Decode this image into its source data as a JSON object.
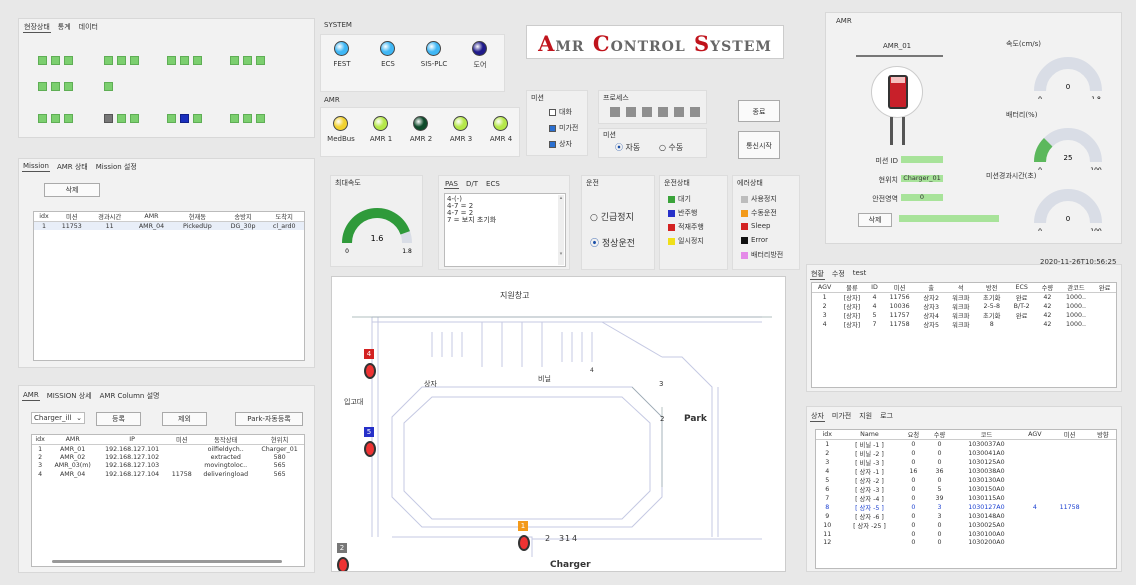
{
  "left_top": {
    "tabs": [
      "현장상태",
      "통계",
      "데이터"
    ]
  },
  "mission_panel": {
    "tabs": [
      "Mission",
      "AMR 상태",
      "Mission 설정"
    ],
    "delete_btn": "삭제",
    "headers": [
      "idx",
      "미션",
      "경과시간",
      "AMR",
      "현재동",
      "송방지",
      "도착지"
    ],
    "rows": [
      [
        "1",
        "11753",
        "11",
        "AMR_04",
        "PickedUp",
        "DG_30p",
        "cl_ard0"
      ]
    ]
  },
  "amr_panel": {
    "tabs": [
      "AMR",
      "MISSION 상세",
      "AMR Column 설명"
    ],
    "select_value": "Charger_ill",
    "btn_register": "등록",
    "btn_delete": "제외",
    "btn_park": "Park-자동등록",
    "headers": [
      "idx",
      "AMR",
      "IP",
      "미션",
      "동작상태",
      "현위치"
    ],
    "rows": [
      [
        "1",
        "AMR_01",
        "192.168.127.101",
        "",
        "oilfieldych..",
        "Charger_01"
      ],
      [
        "2",
        "AMR_02",
        "192.168.127.102",
        "",
        "extracted",
        "580"
      ],
      [
        "3",
        "AMR_03(m)",
        "192.168.127.103",
        "",
        "movingtoloc..",
        "565"
      ],
      [
        "4",
        "AMR_04",
        "192.168.127.104",
        "11758",
        "deliveringload",
        "565"
      ]
    ]
  },
  "system": {
    "title": "SYSTEM",
    "leds": [
      {
        "label": "FEST",
        "color": "#3fb7f5"
      },
      {
        "label": "ECS",
        "color": "#3fb7f5"
      },
      {
        "label": "SIS-PLC",
        "color": "#3fb7f5"
      },
      {
        "label": "도어",
        "color": "#1f1a8a"
      }
    ]
  },
  "amr_leds": {
    "title": "AMR",
    "leds": [
      {
        "label": "MedBus",
        "color": "#f2d230"
      },
      {
        "label": "AMR 1",
        "color": "#b6e84a"
      },
      {
        "label": "AMR 2",
        "color": "#0d4a2a"
      },
      {
        "label": "AMR 3",
        "color": "#b6e84a"
      },
      {
        "label": "AMR 4",
        "color": "#b6e84a"
      }
    ]
  },
  "brand": {
    "title": "AMR CONTROL SYSTEM"
  },
  "mission_opts": {
    "title": "미션",
    "items": [
      {
        "label": "대화",
        "checked": false
      },
      {
        "label": "미가전",
        "checked": true
      },
      {
        "label": "상자",
        "checked": true
      }
    ]
  },
  "process": {
    "title": "프로세스"
  },
  "mode": {
    "title": "미션",
    "auto": "자동",
    "manual": "수동"
  },
  "btn_end": "종료",
  "btn_comm": "통신시작",
  "speed": {
    "title": "최대속도",
    "value": "1.6",
    "min": "0",
    "max": "1.8",
    "fill": 0.89
  },
  "log_panel": {
    "tabs": [
      "PAS",
      "D/T",
      "ECS"
    ],
    "lines": [
      "4-(-)",
      "4-7  =  2",
      "4-7  =  2",
      "7  =  보지 초기화"
    ]
  },
  "run": {
    "title": "운전",
    "emergency": "긴급정지",
    "normal": "정상운전"
  },
  "run_state": {
    "title": "운전상태",
    "items": [
      {
        "label": "대기",
        "color": "#3aa33a"
      },
      {
        "label": "반주행",
        "color": "#2630c9"
      },
      {
        "label": "적재주행",
        "color": "#d32222"
      },
      {
        "label": "일시정지",
        "color": "#f0df1a"
      }
    ]
  },
  "err_state": {
    "title": "에러상태",
    "items": [
      {
        "label": "사용정지",
        "color": "#bdbdbd"
      },
      {
        "label": "수동운전",
        "color": "#f39a1a"
      },
      {
        "label": "Sleep",
        "color": "#d32222"
      },
      {
        "label": "Error",
        "color": "#111111"
      },
      {
        "label": "배터리방전",
        "color": "#e48ae8"
      }
    ]
  },
  "map": {
    "labels": [
      "지원창고",
      "상자",
      "비닐",
      "입고대",
      "Park",
      "Charger",
      "1",
      "2",
      "3",
      "4",
      "2",
      "3",
      "4"
    ],
    "markers": [
      {
        "n": "4",
        "color": "#d32222"
      },
      {
        "n": "5",
        "color": "#2630c9"
      },
      {
        "n": "1",
        "color": "#f39a1a"
      },
      {
        "n": "2",
        "color": "#777777"
      }
    ]
  },
  "amr_detail": {
    "title": "AMR",
    "name": "AMR_01",
    "fields": [
      {
        "label": "미션 ID",
        "value": ""
      },
      {
        "label": "현위치",
        "value": "Charger_01"
      },
      {
        "label": "안전영역",
        "value": "0"
      }
    ],
    "delete_btn": "삭제",
    "g1": {
      "title": "속도(cm/s)",
      "value": "0",
      "min": "0",
      "max": "1.8",
      "fill": 0
    },
    "g2": {
      "title": "배터리(%)",
      "value": "25",
      "min": "0",
      "max": "100",
      "fill": 0.25
    },
    "g3": {
      "title": "미션경과시간(초)",
      "value": "0",
      "min": "0",
      "max": "100",
      "fill": 0
    }
  },
  "timestamp": "2020-11-26T10:56:25",
  "status_table": {
    "tabs": [
      "현황",
      "수정",
      "test"
    ],
    "headers": [
      "AGV",
      "물류",
      "ID",
      "미션",
      "출",
      "석",
      "방전",
      "ECS",
      "수량",
      "관코드",
      "완료"
    ],
    "rows": [
      [
        "1",
        "[상자]",
        "4",
        "11756",
        "상자2",
        "워크파",
        "초기화",
        "완료",
        "42",
        "1000..",
        ""
      ],
      [
        "2",
        "[상자]",
        "4",
        "10036",
        "상자3",
        "워크파",
        "2-5-8",
        "B/T-2",
        "42",
        "1000..",
        ""
      ],
      [
        "3",
        "[상자]",
        "5",
        "11757",
        "상자4",
        "워크파",
        "초기화",
        "완료",
        "42",
        "1000..",
        ""
      ],
      [
        "4",
        "[상자]",
        "7",
        "11758",
        "상자5",
        "워크파",
        "8",
        "",
        "42",
        "1000..",
        ""
      ]
    ]
  },
  "stock_table": {
    "tabs": [
      "상자",
      "미가전",
      "지원",
      "로그"
    ],
    "headers": [
      "idx",
      "Name",
      "요청",
      "수량",
      "코드",
      "AGV",
      "미션",
      "방향"
    ],
    "rows": [
      [
        "1",
        "[ 비닐 -1 ]",
        "0",
        "0",
        "1030037A0",
        "",
        "",
        ""
      ],
      [
        "2",
        "[ 비닐 -2 ]",
        "0",
        "0",
        "1030041A0",
        "",
        "",
        ""
      ],
      [
        "3",
        "[ 비닐 -3 ]",
        "0",
        "0",
        "1030125A0",
        "",
        "",
        ""
      ],
      [
        "4",
        "[ 상자 -1 ]",
        "16",
        "36",
        "1030038A0",
        "",
        "",
        ""
      ],
      [
        "5",
        "[ 상자 -2 ]",
        "0",
        "0",
        "1030130A0",
        "",
        "",
        ""
      ],
      [
        "6",
        "[ 상자 -3 ]",
        "0",
        "5",
        "1030150A0",
        "",
        "",
        ""
      ],
      [
        "7",
        "[ 상자 -4 ]",
        "0",
        "39",
        "1030115A0",
        "",
        "",
        ""
      ],
      [
        "8",
        "[ 상자 -5 ]",
        "0",
        "3",
        "1030127A0",
        "4",
        "11758",
        ""
      ],
      [
        "9",
        "[ 상자 -6 ]",
        "0",
        "3",
        "1030148A0",
        "",
        "",
        ""
      ],
      [
        "10",
        "[ 상자 -25 ]",
        "0",
        "0",
        "1030025A0",
        "",
        "",
        ""
      ],
      [
        "11",
        "",
        "0",
        "0",
        "1030100A0",
        "",
        "",
        ""
      ],
      [
        "12",
        "",
        "0",
        "0",
        "1030200A0",
        "",
        "",
        ""
      ]
    ]
  }
}
